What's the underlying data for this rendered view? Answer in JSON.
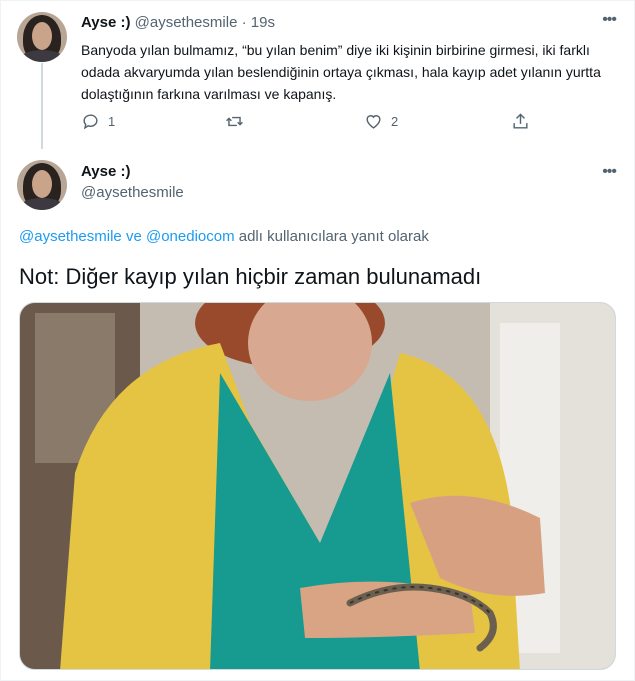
{
  "tweet1": {
    "author_name": "Ayse :)",
    "author_handle": "@aysethesmile",
    "separator": "·",
    "time": "19s",
    "text": "Banyoda yılan bulmamız, “bu yılan benim” diye iki kişinin birbirine girmesi, iki farklı odada akvaryumda yılan beslendiğinin ortaya çıkması, hala kayıp adet yılanın yurtta dolaştığının farkına varılması ve kapanış.",
    "actions": {
      "reply_count": "1",
      "retweet_count": "",
      "like_count": "2",
      "share_count": ""
    }
  },
  "tweet2": {
    "author_name": "Ayse :)",
    "author_handle": "@aysethesmile",
    "reply_to": {
      "mention1": "@aysethesmile",
      "joiner": " ve ",
      "mention2": "@onediocom",
      "suffix": " adlı kullanıcılara yanıt olarak"
    },
    "text": "Not: Diğer kayıp yılan hiçbir zaman bulunamadı"
  },
  "icons": {
    "reply": "reply-icon",
    "retweet": "retweet-icon",
    "like": "heart-icon",
    "share": "share-icon",
    "more": "more-icon"
  },
  "colors": {
    "text": "#0f1419",
    "secondary": "#536471",
    "link": "#1d9bf0",
    "border": "#eff3f4"
  }
}
